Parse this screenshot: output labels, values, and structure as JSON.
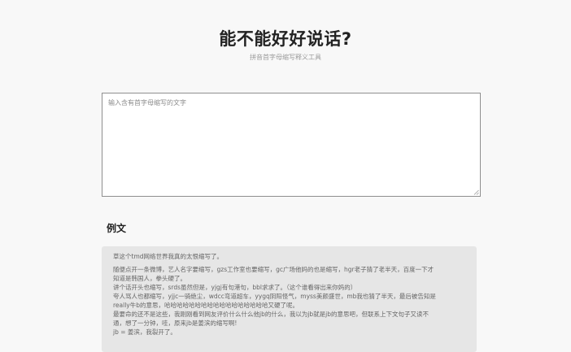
{
  "header": {
    "title": "能不能好好说话?",
    "subtitle": "拼音首字母缩写释义工具"
  },
  "input": {
    "placeholder": "输入含有首字母缩写的文字",
    "value": ""
  },
  "example": {
    "heading": "例文",
    "intro": "草这个tmd网络世界我真的太恨缩写了。",
    "lines": [
      "随便点开一条微博，艺人名字要缩写，gzs工作室也要缩写，gc广场他妈的也是缩写，hgr老子猜了老半天，百度一下才",
      "知道是韩国人，拳头硬了。",
      "讲个话开头也缩写，srds虽然但是，yjgj有句港句，bbl求求了。（这个谁看得出来你妈的）",
      "夸人骂人也都缩写，yjjc一骑绝尘，wdcc弯道超车，yygq阴阳怪气，myss美颜盛世，mb我也猜了半天，最后被告知是",
      "really牛b的意思，哈哈哈哈哈哈哈哈哈哈哈哈哈哈哈哈哈又硬了呢。",
      "最要命的还不是这些，我刚刚看到网友评价什么什么他jb的什么，我以为jb就是jb的意思吧，但联系上下文句子又读不",
      "通，想了一分钟，哇，原来jb是姜滨的缩写啊!",
      "jb = 姜滨，我裂开了。"
    ]
  }
}
